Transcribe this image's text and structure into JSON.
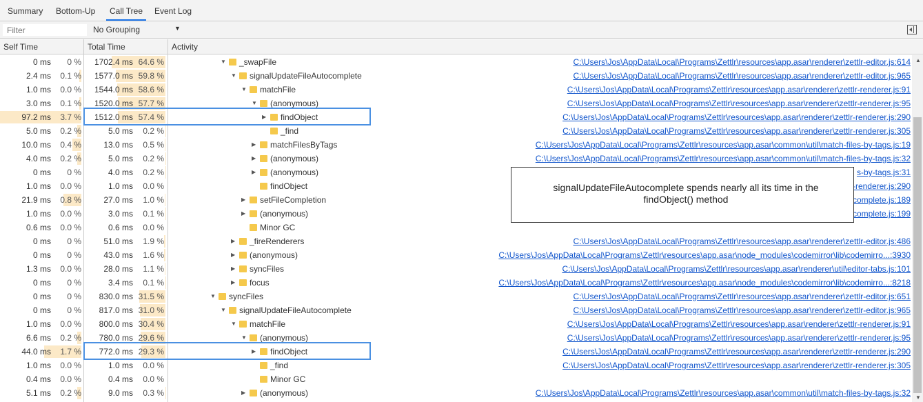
{
  "tabs": [
    {
      "label": "Summary",
      "active": false
    },
    {
      "label": "Bottom-Up",
      "active": false
    },
    {
      "label": "Call Tree",
      "active": true
    },
    {
      "label": "Event Log",
      "active": false
    }
  ],
  "filter": {
    "placeholder": "Filter",
    "grouping": "No Grouping"
  },
  "columns": {
    "self_time": "Self Time",
    "total_time": "Total Time",
    "activity": "Activity"
  },
  "accent_color": "#4a90e2",
  "heat_color": "#fce9c7",
  "rows": [
    {
      "self_ms": "0 ms",
      "self_pct": "0 %",
      "total_ms": "1702.4 ms",
      "total_pct": "64.6 %",
      "level": 7,
      "expanded": true,
      "name": "_swapFile",
      "url": "C:\\Users\\Jos\\AppData\\Local\\Programs\\Zettlr\\resources\\app.asar\\renderer\\zettlr-editor.js:614"
    },
    {
      "self_ms": "2.4 ms",
      "self_pct": "0.1 %",
      "total_ms": "1577.0 ms",
      "total_pct": "59.8 %",
      "level": 8,
      "expanded": true,
      "name": "signalUpdateFileAutocomplete",
      "url": "C:\\Users\\Jos\\AppData\\Local\\Programs\\Zettlr\\resources\\app.asar\\renderer\\zettlr-editor.js:965"
    },
    {
      "self_ms": "1.0 ms",
      "self_pct": "0.0 %",
      "total_ms": "1544.0 ms",
      "total_pct": "58.6 %",
      "level": 9,
      "expanded": true,
      "name": "matchFile",
      "url": "C:\\Users\\Jos\\AppData\\Local\\Programs\\Zettlr\\resources\\app.asar\\renderer\\zettlr-renderer.js:91"
    },
    {
      "self_ms": "3.0 ms",
      "self_pct": "0.1 %",
      "total_ms": "1520.0 ms",
      "total_pct": "57.7 %",
      "level": 10,
      "expanded": true,
      "name": "(anonymous)",
      "url": "C:\\Users\\Jos\\AppData\\Local\\Programs\\Zettlr\\resources\\app.asar\\renderer\\zettlr-renderer.js:95"
    },
    {
      "self_ms": "97.2 ms",
      "self_pct": "3.7 %",
      "total_ms": "1512.0 ms",
      "total_pct": "57.4 %",
      "level": 11,
      "expanded": false,
      "name": "findObject",
      "url": "C:\\Users\\Jos\\AppData\\Local\\Programs\\Zettlr\\resources\\app.asar\\renderer\\zettlr-renderer.js:290"
    },
    {
      "self_ms": "5.0 ms",
      "self_pct": "0.2 %",
      "total_ms": "5.0 ms",
      "total_pct": "0.2 %",
      "level": 11,
      "leaf": true,
      "name": "_find",
      "url": "C:\\Users\\Jos\\AppData\\Local\\Programs\\Zettlr\\resources\\app.asar\\renderer\\zettlr-renderer.js:305"
    },
    {
      "self_ms": "10.0 ms",
      "self_pct": "0.4 %",
      "total_ms": "13.0 ms",
      "total_pct": "0.5 %",
      "level": 10,
      "expanded": false,
      "name": "matchFilesByTags",
      "url": "C:\\Users\\Jos\\AppData\\Local\\Programs\\Zettlr\\resources\\app.asar\\common\\util\\match-files-by-tags.js:19"
    },
    {
      "self_ms": "4.0 ms",
      "self_pct": "0.2 %",
      "total_ms": "5.0 ms",
      "total_pct": "0.2 %",
      "level": 10,
      "expanded": false,
      "name": "(anonymous)",
      "url": "C:\\Users\\Jos\\AppData\\Local\\Programs\\Zettlr\\resources\\app.asar\\common\\util\\match-files-by-tags.js:32"
    },
    {
      "self_ms": "0 ms",
      "self_pct": "0 %",
      "total_ms": "4.0 ms",
      "total_pct": "0.2 %",
      "level": 10,
      "expanded": false,
      "name": "(anonymous)",
      "url": "s-by-tags.js:31"
    },
    {
      "self_ms": "1.0 ms",
      "self_pct": "0.0 %",
      "total_ms": "1.0 ms",
      "total_pct": "0.0 %",
      "level": 10,
      "leaf": true,
      "name": "findObject",
      "url": "-renderer.js:290"
    },
    {
      "self_ms": "21.9 ms",
      "self_pct": "0.8 %",
      "total_ms": "27.0 ms",
      "total_pct": "1.0 %",
      "level": 9,
      "expanded": false,
      "name": "setFileCompletion",
      "url": "complete.js:189"
    },
    {
      "self_ms": "1.0 ms",
      "self_pct": "0.0 %",
      "total_ms": "3.0 ms",
      "total_pct": "0.1 %",
      "level": 9,
      "expanded": false,
      "name": "(anonymous)",
      "url": "complete.js:199"
    },
    {
      "self_ms": "0.6 ms",
      "self_pct": "0.0 %",
      "total_ms": "0.6 ms",
      "total_pct": "0.0 %",
      "level": 9,
      "leaf": true,
      "name": "Minor GC",
      "url": ""
    },
    {
      "self_ms": "0 ms",
      "self_pct": "0 %",
      "total_ms": "51.0 ms",
      "total_pct": "1.9 %",
      "level": 8,
      "expanded": false,
      "name": "_fireRenderers",
      "url": "C:\\Users\\Jos\\AppData\\Local\\Programs\\Zettlr\\resources\\app.asar\\renderer\\zettlr-editor.js:486"
    },
    {
      "self_ms": "0 ms",
      "self_pct": "0 %",
      "total_ms": "43.0 ms",
      "total_pct": "1.6 %",
      "level": 8,
      "expanded": false,
      "name": "(anonymous)",
      "url": "C:\\Users\\Jos\\AppData\\Local\\Programs\\Zettlr\\resources\\app.asar\\node_modules\\codemirror\\lib\\codemirro...:3930"
    },
    {
      "self_ms": "1.3 ms",
      "self_pct": "0.0 %",
      "total_ms": "28.0 ms",
      "total_pct": "1.1 %",
      "level": 8,
      "expanded": false,
      "name": "syncFiles",
      "url": "C:\\Users\\Jos\\AppData\\Local\\Programs\\Zettlr\\resources\\app.asar\\renderer\\util\\editor-tabs.js:101"
    },
    {
      "self_ms": "0 ms",
      "self_pct": "0 %",
      "total_ms": "3.4 ms",
      "total_pct": "0.1 %",
      "level": 8,
      "expanded": false,
      "name": "focus",
      "url": "C:\\Users\\Jos\\AppData\\Local\\Programs\\Zettlr\\resources\\app.asar\\node_modules\\codemirror\\lib\\codemirro...:8218"
    },
    {
      "self_ms": "0 ms",
      "self_pct": "0 %",
      "total_ms": "830.0 ms",
      "total_pct": "31.5 %",
      "level": 6,
      "expanded": true,
      "name": "syncFiles",
      "url": "C:\\Users\\Jos\\AppData\\Local\\Programs\\Zettlr\\resources\\app.asar\\renderer\\zettlr-editor.js:651"
    },
    {
      "self_ms": "0 ms",
      "self_pct": "0 %",
      "total_ms": "817.0 ms",
      "total_pct": "31.0 %",
      "level": 7,
      "expanded": true,
      "name": "signalUpdateFileAutocomplete",
      "url": "C:\\Users\\Jos\\AppData\\Local\\Programs\\Zettlr\\resources\\app.asar\\renderer\\zettlr-editor.js:965"
    },
    {
      "self_ms": "1.0 ms",
      "self_pct": "0.0 %",
      "total_ms": "800.0 ms",
      "total_pct": "30.4 %",
      "level": 8,
      "expanded": true,
      "name": "matchFile",
      "url": "C:\\Users\\Jos\\AppData\\Local\\Programs\\Zettlr\\resources\\app.asar\\renderer\\zettlr-renderer.js:91"
    },
    {
      "self_ms": "6.6 ms",
      "self_pct": "0.2 %",
      "total_ms": "780.0 ms",
      "total_pct": "29.6 %",
      "level": 9,
      "expanded": true,
      "name": "(anonymous)",
      "url": "C:\\Users\\Jos\\AppData\\Local\\Programs\\Zettlr\\resources\\app.asar\\renderer\\zettlr-renderer.js:95"
    },
    {
      "self_ms": "44.0 ms",
      "self_pct": "1.7 %",
      "total_ms": "772.0 ms",
      "total_pct": "29.3 %",
      "level": 10,
      "expanded": false,
      "name": "findObject",
      "url": "C:\\Users\\Jos\\AppData\\Local\\Programs\\Zettlr\\resources\\app.asar\\renderer\\zettlr-renderer.js:290"
    },
    {
      "self_ms": "1.0 ms",
      "self_pct": "0.0 %",
      "total_ms": "1.0 ms",
      "total_pct": "0.0 %",
      "level": 10,
      "leaf": true,
      "name": "_find",
      "url": "C:\\Users\\Jos\\AppData\\Local\\Programs\\Zettlr\\resources\\app.asar\\renderer\\zettlr-renderer.js:305"
    },
    {
      "self_ms": "0.4 ms",
      "self_pct": "0.0 %",
      "total_ms": "0.4 ms",
      "total_pct": "0.0 %",
      "level": 10,
      "leaf": true,
      "name": "Minor GC",
      "url": ""
    },
    {
      "self_ms": "5.1 ms",
      "self_pct": "0.2 %",
      "total_ms": "9.0 ms",
      "total_pct": "0.3 %",
      "level": 9,
      "expanded": false,
      "name": "(anonymous)",
      "url": "C:\\Users\\Jos\\AppData\\Local\\Programs\\Zettlr\\resources\\app.asar\\common\\util\\match-files-by-tags.js:32"
    }
  ],
  "callout": {
    "text": "signalUpdateFileAutocomplete spends nearly all its time in the findObject() method"
  }
}
